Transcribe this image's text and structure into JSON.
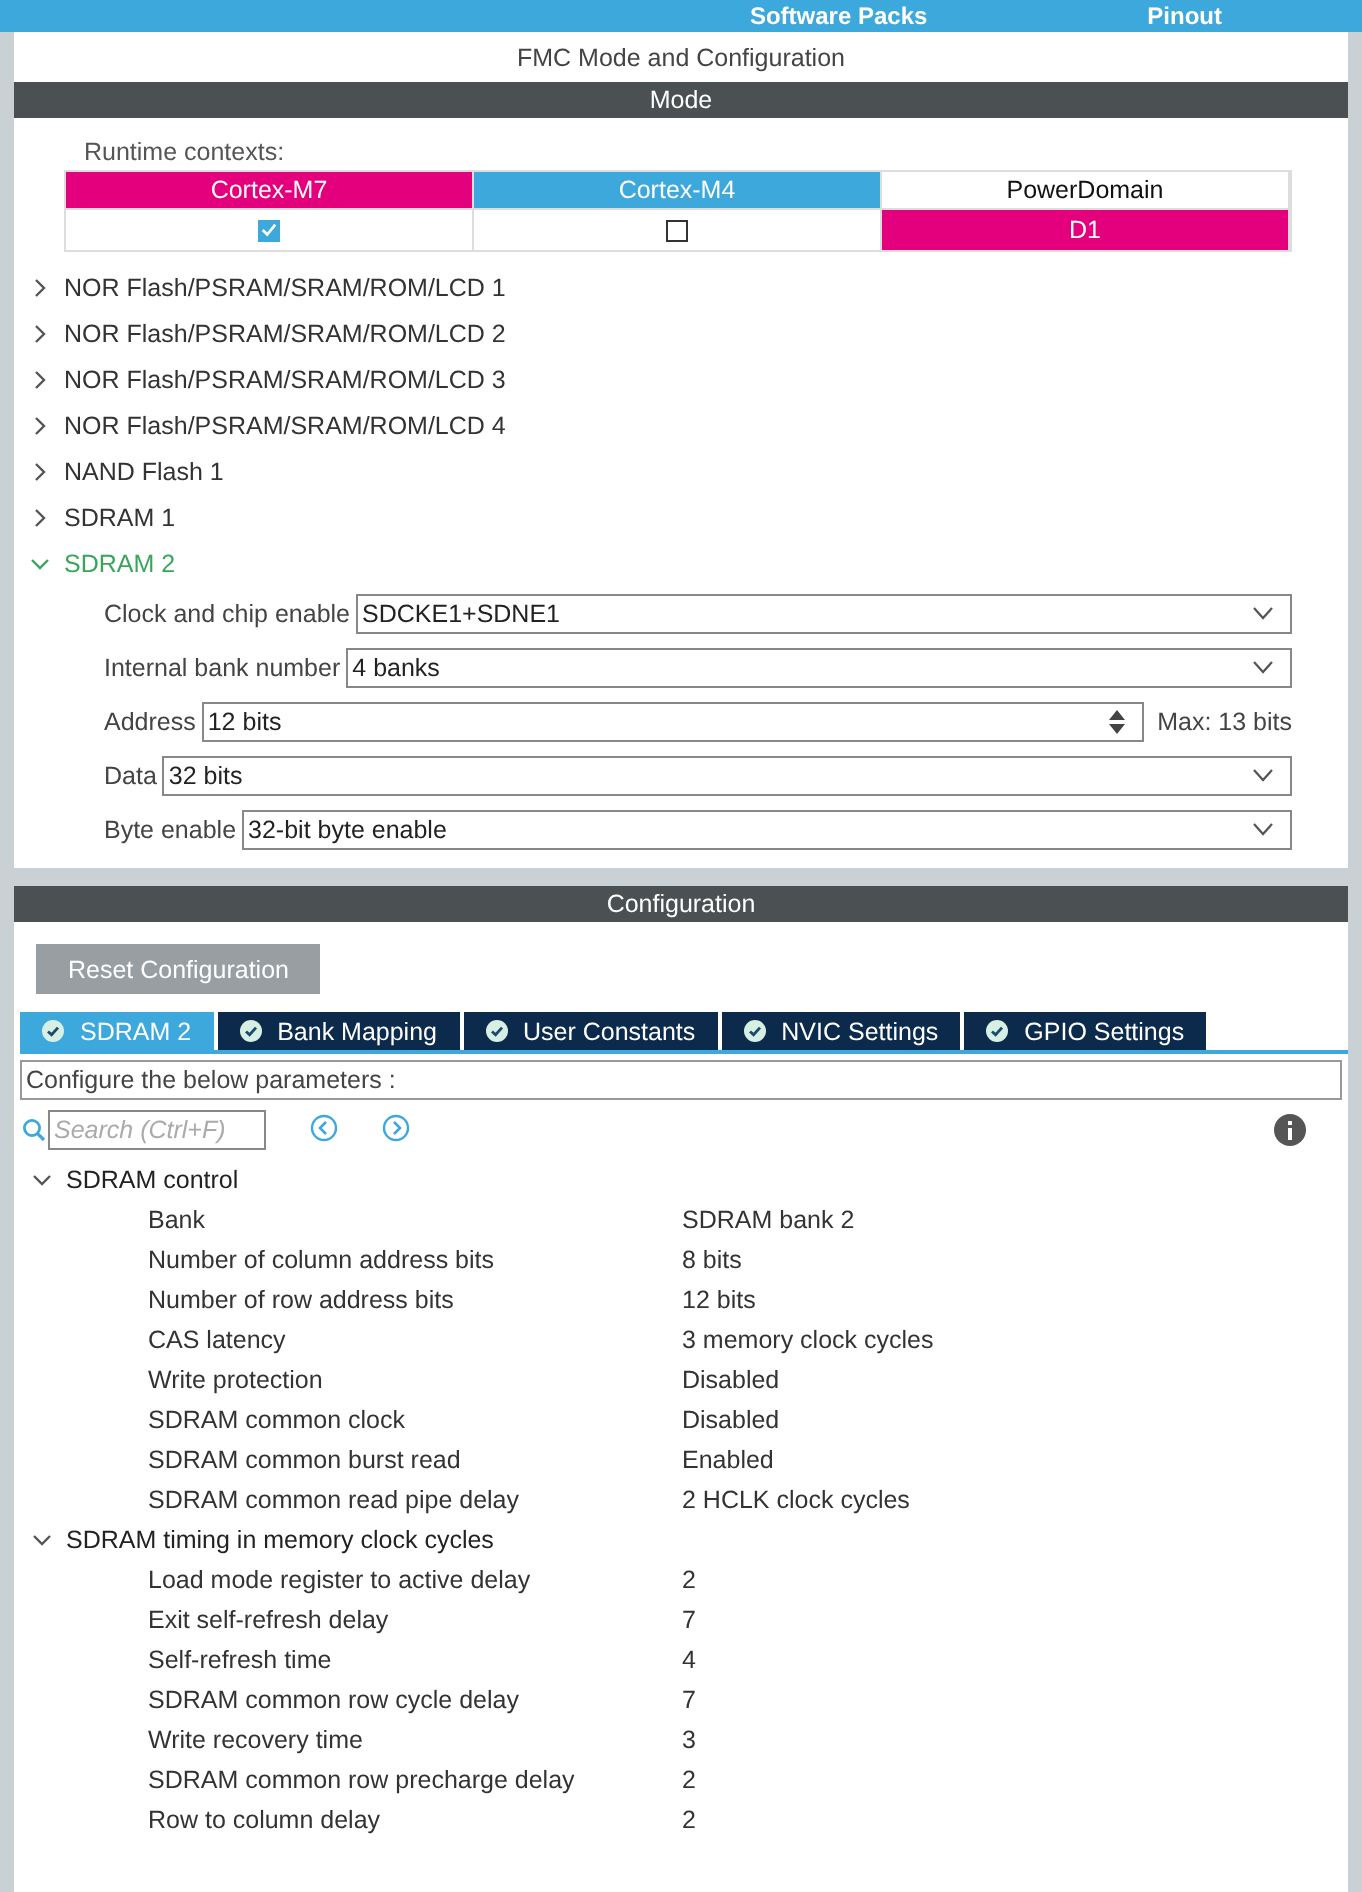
{
  "top_bar": {
    "items": [
      "Software Packs",
      "Pinout"
    ]
  },
  "panel_title": "FMC Mode and Configuration",
  "mode": {
    "header": "Mode",
    "runtime_label": "Runtime contexts:",
    "contexts": [
      {
        "kind": "checkbox",
        "label": "Cortex-M7",
        "color": "#e4007c",
        "checked": true
      },
      {
        "kind": "checkbox",
        "label": "Cortex-M4",
        "color": "#3ca8dc",
        "checked": false
      },
      {
        "kind": "value",
        "label": "PowerDomain",
        "value": "D1",
        "color": "#e4007c"
      }
    ],
    "items": [
      {
        "label": "NOR Flash/PSRAM/SRAM/ROM/LCD 1",
        "expanded": false
      },
      {
        "label": "NOR Flash/PSRAM/SRAM/ROM/LCD 2",
        "expanded": false
      },
      {
        "label": "NOR Flash/PSRAM/SRAM/ROM/LCD 3",
        "expanded": false
      },
      {
        "label": "NOR Flash/PSRAM/SRAM/ROM/LCD 4",
        "expanded": false
      },
      {
        "label": "NAND Flash 1",
        "expanded": false
      },
      {
        "label": "SDRAM 1",
        "expanded": false
      },
      {
        "label": "SDRAM 2",
        "expanded": true,
        "fields": [
          {
            "kind": "select",
            "label": "Clock and chip enable",
            "value": "SDCKE1+SDNE1"
          },
          {
            "kind": "select",
            "label": "Internal bank number",
            "value": "4 banks"
          },
          {
            "kind": "spin",
            "label": "Address",
            "value": "12 bits",
            "note": "Max: 13 bits"
          },
          {
            "kind": "select",
            "label": "Data",
            "value": "32 bits"
          },
          {
            "kind": "select",
            "label": "Byte enable",
            "value": "32-bit byte enable"
          }
        ]
      }
    ]
  },
  "configuration": {
    "header": "Configuration",
    "reset_button": "Reset Configuration",
    "tabs": [
      {
        "label": "SDRAM 2",
        "selected": true
      },
      {
        "label": "Bank Mapping",
        "selected": false
      },
      {
        "label": "User Constants",
        "selected": false
      },
      {
        "label": "NVIC Settings",
        "selected": false
      },
      {
        "label": "GPIO Settings",
        "selected": false
      }
    ],
    "hint": "Configure the below parameters :",
    "search": {
      "placeholder": "Search (Ctrl+F)"
    },
    "groups": [
      {
        "label": "SDRAM control",
        "expanded": true,
        "params": [
          {
            "name": "Bank",
            "value": "SDRAM bank 2"
          },
          {
            "name": "Number of column address bits",
            "value": "8 bits"
          },
          {
            "name": "Number of row address bits",
            "value": "12 bits"
          },
          {
            "name": "CAS latency",
            "value": "3 memory clock cycles"
          },
          {
            "name": "Write protection",
            "value": "Disabled"
          },
          {
            "name": "SDRAM common clock",
            "value": "Disabled"
          },
          {
            "name": "SDRAM common burst read",
            "value": "Enabled"
          },
          {
            "name": "SDRAM common read pipe delay",
            "value": "2 HCLK clock cycles"
          }
        ]
      },
      {
        "label": "SDRAM timing in memory clock cycles",
        "expanded": true,
        "params": [
          {
            "name": "Load mode register to active delay",
            "value": "2"
          },
          {
            "name": "Exit self-refresh delay",
            "value": "7"
          },
          {
            "name": "Self-refresh time",
            "value": "4"
          },
          {
            "name": "SDRAM common row cycle delay",
            "value": "7"
          },
          {
            "name": "Write recovery time",
            "value": "3"
          },
          {
            "name": "SDRAM common row precharge delay",
            "value": "2"
          },
          {
            "name": "Row to column delay",
            "value": "2"
          }
        ]
      }
    ]
  }
}
